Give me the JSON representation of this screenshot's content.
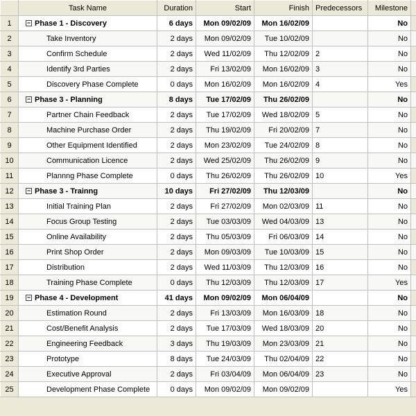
{
  "columns": {
    "name": "Task Name",
    "duration": "Duration",
    "start": "Start",
    "finish": "Finish",
    "pred": "Predecessors",
    "milestone": "Milestone"
  },
  "outline_symbol": "−",
  "rows": [
    {
      "n": 1,
      "summary": true,
      "name": "Phase 1 - Discovery",
      "dur": "6 days",
      "start": "Mon 09/02/09",
      "fin": "Mon 16/02/09",
      "pred": "",
      "mile": "No"
    },
    {
      "n": 2,
      "summary": false,
      "name": "Take Inventory",
      "dur": "2 days",
      "start": "Mon 09/02/09",
      "fin": "Tue 10/02/09",
      "pred": "",
      "mile": "No"
    },
    {
      "n": 3,
      "summary": false,
      "name": "Confirm Schedule",
      "dur": "2 days",
      "start": "Wed 11/02/09",
      "fin": "Thu 12/02/09",
      "pred": "2",
      "mile": "No"
    },
    {
      "n": 4,
      "summary": false,
      "name": "Identify 3rd Parties",
      "dur": "2 days",
      "start": "Fri 13/02/09",
      "fin": "Mon 16/02/09",
      "pred": "3",
      "mile": "No"
    },
    {
      "n": 5,
      "summary": false,
      "name": "Discovery Phase Complete",
      "dur": "0 days",
      "start": "Mon 16/02/09",
      "fin": "Mon 16/02/09",
      "pred": "4",
      "mile": "Yes"
    },
    {
      "n": 6,
      "summary": true,
      "name": "Phase 3 - Planning",
      "dur": "8 days",
      "start": "Tue 17/02/09",
      "fin": "Thu 26/02/09",
      "pred": "",
      "mile": "No"
    },
    {
      "n": 7,
      "summary": false,
      "name": "Partner Chain Feedback",
      "dur": "2 days",
      "start": "Tue 17/02/09",
      "fin": "Wed 18/02/09",
      "pred": "5",
      "mile": "No"
    },
    {
      "n": 8,
      "summary": false,
      "name": "Machine Purchase Order",
      "dur": "2 days",
      "start": "Thu 19/02/09",
      "fin": "Fri 20/02/09",
      "pred": "7",
      "mile": "No"
    },
    {
      "n": 9,
      "summary": false,
      "name": "Other Equipment Identified",
      "dur": "2 days",
      "start": "Mon 23/02/09",
      "fin": "Tue 24/02/09",
      "pred": "8",
      "mile": "No"
    },
    {
      "n": 10,
      "summary": false,
      "name": "Communication Licence",
      "dur": "2 days",
      "start": "Wed 25/02/09",
      "fin": "Thu 26/02/09",
      "pred": "9",
      "mile": "No"
    },
    {
      "n": 11,
      "summary": false,
      "name": "Plannng Phase Complete",
      "dur": "0 days",
      "start": "Thu 26/02/09",
      "fin": "Thu 26/02/09",
      "pred": "10",
      "mile": "Yes"
    },
    {
      "n": 12,
      "summary": true,
      "name": "Phase 3 - Trainng",
      "dur": "10 days",
      "start": "Fri 27/02/09",
      "fin": "Thu 12/03/09",
      "pred": "",
      "mile": "No"
    },
    {
      "n": 13,
      "summary": false,
      "name": "Initial Training Plan",
      "dur": "2 days",
      "start": "Fri 27/02/09",
      "fin": "Mon 02/03/09",
      "pred": "11",
      "mile": "No"
    },
    {
      "n": 14,
      "summary": false,
      "name": "Focus Group Testing",
      "dur": "2 days",
      "start": "Tue 03/03/09",
      "fin": "Wed 04/03/09",
      "pred": "13",
      "mile": "No"
    },
    {
      "n": 15,
      "summary": false,
      "name": "Online Availability",
      "dur": "2 days",
      "start": "Thu 05/03/09",
      "fin": "Fri 06/03/09",
      "pred": "14",
      "mile": "No"
    },
    {
      "n": 16,
      "summary": false,
      "name": "Print Shop Order",
      "dur": "2 days",
      "start": "Mon 09/03/09",
      "fin": "Tue 10/03/09",
      "pred": "15",
      "mile": "No"
    },
    {
      "n": 17,
      "summary": false,
      "name": "Distribution",
      "dur": "2 days",
      "start": "Wed 11/03/09",
      "fin": "Thu 12/03/09",
      "pred": "16",
      "mile": "No"
    },
    {
      "n": 18,
      "summary": false,
      "name": "Training Phase Complete",
      "dur": "0 days",
      "start": "Thu 12/03/09",
      "fin": "Thu 12/03/09",
      "pred": "17",
      "mile": "Yes"
    },
    {
      "n": 19,
      "summary": true,
      "name": "Phase 4 - Development",
      "dur": "41 days",
      "start": "Mon 09/02/09",
      "fin": "Mon 06/04/09",
      "pred": "",
      "mile": "No"
    },
    {
      "n": 20,
      "summary": false,
      "name": "Estimation Round",
      "dur": "2 days",
      "start": "Fri 13/03/09",
      "fin": "Mon 16/03/09",
      "pred": "18",
      "mile": "No"
    },
    {
      "n": 21,
      "summary": false,
      "name": "Cost/Benefit Analysis",
      "dur": "2 days",
      "start": "Tue 17/03/09",
      "fin": "Wed 18/03/09",
      "pred": "20",
      "mile": "No"
    },
    {
      "n": 22,
      "summary": false,
      "name": "Engineering Feedback",
      "dur": "3 days",
      "start": "Thu 19/03/09",
      "fin": "Mon 23/03/09",
      "pred": "21",
      "mile": "No"
    },
    {
      "n": 23,
      "summary": false,
      "name": "Prototype",
      "dur": "8 days",
      "start": "Tue 24/03/09",
      "fin": "Thu 02/04/09",
      "pred": "22",
      "mile": "No"
    },
    {
      "n": 24,
      "summary": false,
      "name": "Executive Approval",
      "dur": "2 days",
      "start": "Fri 03/04/09",
      "fin": "Mon 06/04/09",
      "pred": "23",
      "mile": "No"
    },
    {
      "n": 25,
      "summary": false,
      "name": "Development Phase Complete",
      "dur": "0 days",
      "start": "Mon 09/02/09",
      "fin": "Mon 09/02/09",
      "pred": "",
      "mile": "Yes"
    }
  ]
}
